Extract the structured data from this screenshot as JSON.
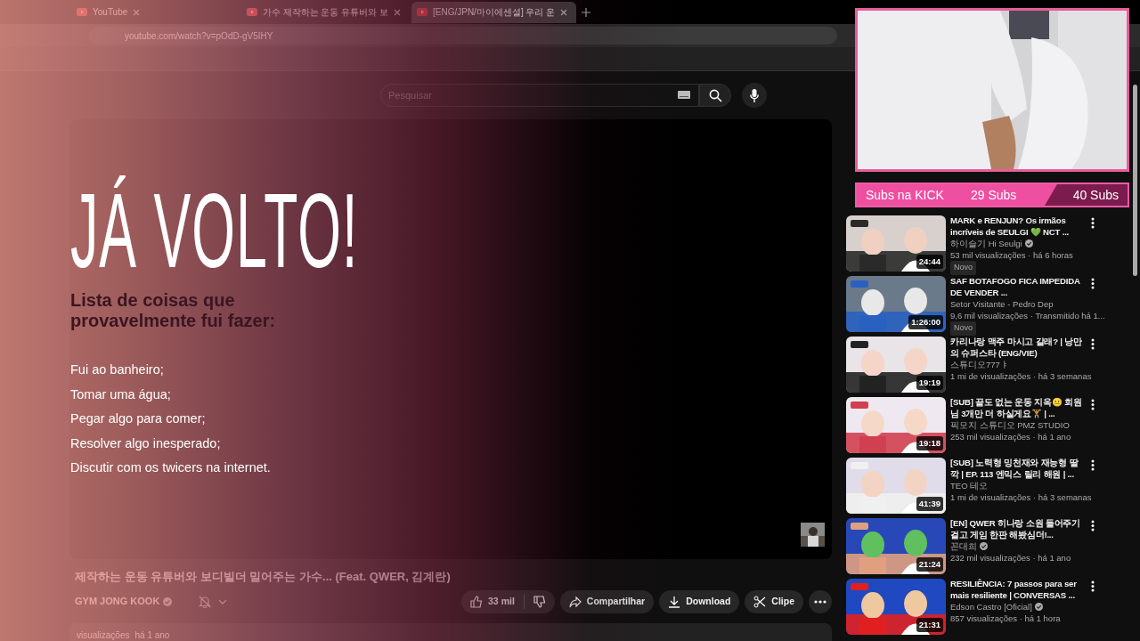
{
  "browser": {
    "tabs": [
      {
        "title": "YouTube",
        "selected": false
      },
      {
        "title": "가수 제작하는 운동 유튜버와 보",
        "selected": false
      },
      {
        "title": "[ENG/JPN/마이에센셜] 우리 운",
        "selected": true
      }
    ],
    "url": "youtube.com/watch?v=pOdD-gV5IHY"
  },
  "header": {
    "search": {
      "placeholder": "Pesquisar"
    }
  },
  "overlay": {
    "heading": "JÁ VOLTO!",
    "list_title": "Lista de coisas que provavelmente fui fazer:",
    "items": [
      "Fui ao banheiro;",
      "Tomar uma água;",
      "Pegar algo para comer;",
      "Resolver algo inesperado;",
      "Discutir com os twicers na internet."
    ]
  },
  "video": {
    "title": "제작하는 운동 유튜버와 보디빌더 밀어주는 가수... (Feat. QWER, 김계란)",
    "channel": "GYM JONG KOOK",
    "verified": true,
    "likes": "33 mil",
    "actions": [
      "Compartilhar",
      "Download",
      "Clipe"
    ],
    "views": "visualizações",
    "age": "há 1 ano"
  },
  "subs": {
    "label": "Subs na KICK",
    "current": "29 Subs",
    "goal": "40 Subs",
    "level": 0.74
  },
  "sidebar": {
    "videos": [
      {
        "title": "MARK e RENJUN? Os irmãos incríveis de SEULGI 💚 NCT ...",
        "channel": "하이슬기 Hi Seulgi",
        "verified": true,
        "meta": "53 mil visualizações · há 6 horas",
        "duration": "24:44",
        "badge": "Novo"
      },
      {
        "title": "SAF BOTAFOGO FICA IMPEDIDA DE VENDER ...",
        "channel": "Setor Visitante - Pedro Dep",
        "verified": false,
        "meta": "9,6 mil visualizações · Transmitido há 1...",
        "duration": "1:26:00",
        "badge": "Novo"
      },
      {
        "title": "카리나랑 맥주 마시고 갈래? | 낭만의 슈퍼스타 (ENG/VIE)",
        "channel": "스튜디오777ㅑ",
        "verified": false,
        "meta": "1 mi de visualizações · há 3 semanas",
        "duration": "19:19"
      },
      {
        "title": "[SUB] 끝도 없는 운동 지옥😐 회원님 3개만 더 하실게요🏋️ | ...",
        "channel": "픽모지 스튜디오 PMZ STUDIO",
        "verified": false,
        "meta": "253 mil visualizações · há 1 ano",
        "duration": "19:18"
      },
      {
        "title": "[SUB] 노력형 밍천재와 재능형 딸깍 | EP. 113 엔믹스 릴리 해원 | ...",
        "channel": "TEO 테오",
        "verified": false,
        "meta": "1 mi de visualizações · há 3 semanas",
        "duration": "41:39"
      },
      {
        "title": "[EN] QWER 히나랑 소원 들어주기 걸고 게임 한판 해봤심더!...",
        "channel": "꼰대희",
        "verified": true,
        "meta": "232 mil visualizações · há 1 ano",
        "duration": "21:24"
      },
      {
        "title": "RESILIÊNCIA: 7 passos para ser mais resiliente | CONVERSAS ...",
        "channel": "Edson Castro [Oficial]",
        "verified": true,
        "meta": "857 visualizações · há 1 hora",
        "duration": "21:31"
      }
    ]
  }
}
